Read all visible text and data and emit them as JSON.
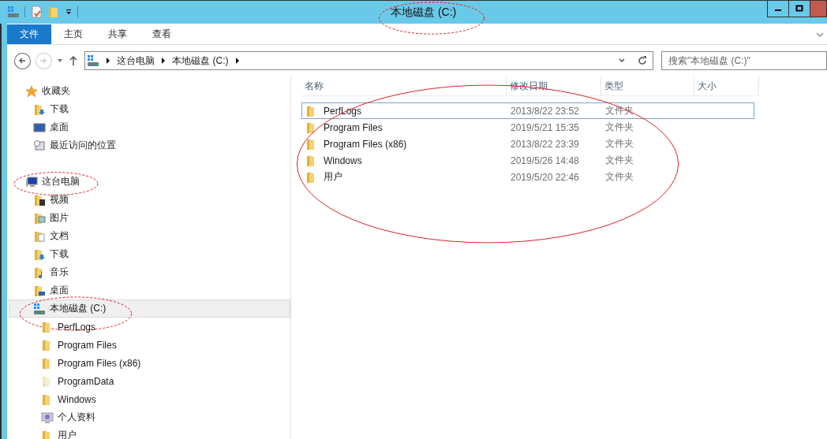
{
  "window": {
    "title": "本地磁盘 (C:)",
    "circled": true
  },
  "ribbon_tabs": [
    {
      "label": "文件",
      "kind": "file"
    },
    {
      "label": "主页",
      "kind": "tab"
    },
    {
      "label": "共享",
      "kind": "tab"
    },
    {
      "label": "查看",
      "kind": "tab"
    }
  ],
  "nav": {
    "back": {
      "disabled": false
    },
    "forward": {
      "disabled": true
    }
  },
  "address": {
    "crumbs": [
      "这台电脑",
      "本地磁盘 (C:)"
    ]
  },
  "search": {
    "placeholder": "搜索\"本地磁盘 (C:)\""
  },
  "sidebar": {
    "items": [
      {
        "label": "收藏夹",
        "kind": "star",
        "selected": false,
        "circled": false,
        "children": [
          {
            "label": "下载",
            "kind": "download",
            "selected": false,
            "circled": false
          },
          {
            "label": "桌面",
            "kind": "desktop",
            "selected": false,
            "circled": false
          },
          {
            "label": "最近访问的位置",
            "kind": "recent",
            "selected": false,
            "circled": false
          }
        ]
      },
      {
        "label": "这台电脑",
        "kind": "computer",
        "selected": false,
        "circled": true,
        "children": [
          {
            "label": "视频",
            "kind": "video",
            "selected": false,
            "circled": false
          },
          {
            "label": "图片",
            "kind": "pictures",
            "selected": false,
            "circled": false
          },
          {
            "label": "文档",
            "kind": "docs",
            "selected": false,
            "circled": false
          },
          {
            "label": "下载",
            "kind": "download",
            "selected": false,
            "circled": false
          },
          {
            "label": "音乐",
            "kind": "music",
            "selected": false,
            "circled": false
          },
          {
            "label": "桌面",
            "kind": "desktop-folder",
            "selected": false,
            "circled": false
          },
          {
            "label": "本地磁盘 (C:)",
            "kind": "drive",
            "selected": true,
            "circled": true,
            "children": [
              {
                "label": "PerfLogs",
                "kind": "folder",
                "selected": false,
                "circled": false
              },
              {
                "label": "Program Files",
                "kind": "folder",
                "selected": false,
                "circled": false
              },
              {
                "label": "Program Files (x86)",
                "kind": "folder",
                "selected": false,
                "circled": false
              },
              {
                "label": "ProgramData",
                "kind": "folder-faded",
                "selected": false,
                "circled": false
              },
              {
                "label": "Windows",
                "kind": "folder",
                "selected": false,
                "circled": false
              },
              {
                "label": "个人资料",
                "kind": "user",
                "selected": false,
                "circled": false
              },
              {
                "label": "用户",
                "kind": "folder",
                "selected": false,
                "circled": false
              }
            ]
          }
        ]
      }
    ]
  },
  "file_list": {
    "circled": true,
    "columns": [
      "名称",
      "修改日期",
      "类型",
      "大小"
    ],
    "rows": [
      {
        "name": "PerfLogs",
        "modified": "2013/8/22 23:52",
        "type": "文件夹",
        "focused": true
      },
      {
        "name": "Program Files",
        "modified": "2019/5/21 15:35",
        "type": "文件夹",
        "focused": false
      },
      {
        "name": "Program Files (x86)",
        "modified": "2013/8/22 23:39",
        "type": "文件夹",
        "focused": false
      },
      {
        "name": "Windows",
        "modified": "2019/5/26 14:48",
        "type": "文件夹",
        "focused": false
      },
      {
        "name": "用户",
        "modified": "2019/5/20 22:46",
        "type": "文件夹",
        "focused": false
      }
    ]
  }
}
